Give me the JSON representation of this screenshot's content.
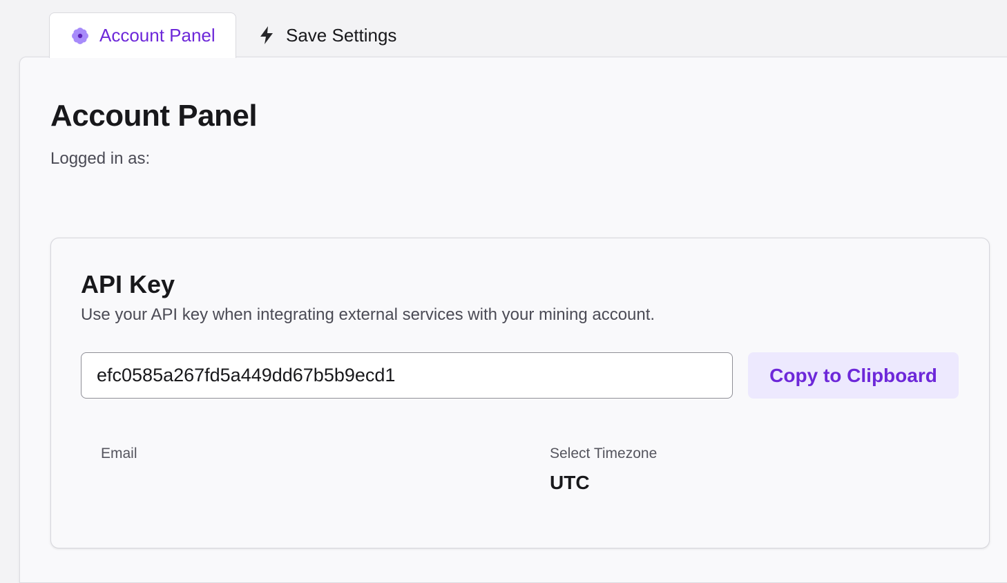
{
  "tabs": [
    {
      "label": "Account Panel",
      "icon": "flower-icon",
      "active": true
    },
    {
      "label": "Save Settings",
      "icon": "lightning-icon",
      "active": false
    }
  ],
  "colors": {
    "accent": "#6d28d9",
    "accent_bg": "#ede9fe"
  },
  "page": {
    "title": "Account Panel",
    "logged_in_label": "Logged in as:"
  },
  "api_key_card": {
    "title": "API Key",
    "description": "Use your API key when integrating external services with your mining account.",
    "key_value": "efc0585a267fd5a449dd67b5b9ecd1",
    "copy_button_label": "Copy to Clipboard"
  },
  "fields": {
    "email_label": "Email",
    "timezone_label": "Select Timezone",
    "timezone_value": "UTC"
  }
}
